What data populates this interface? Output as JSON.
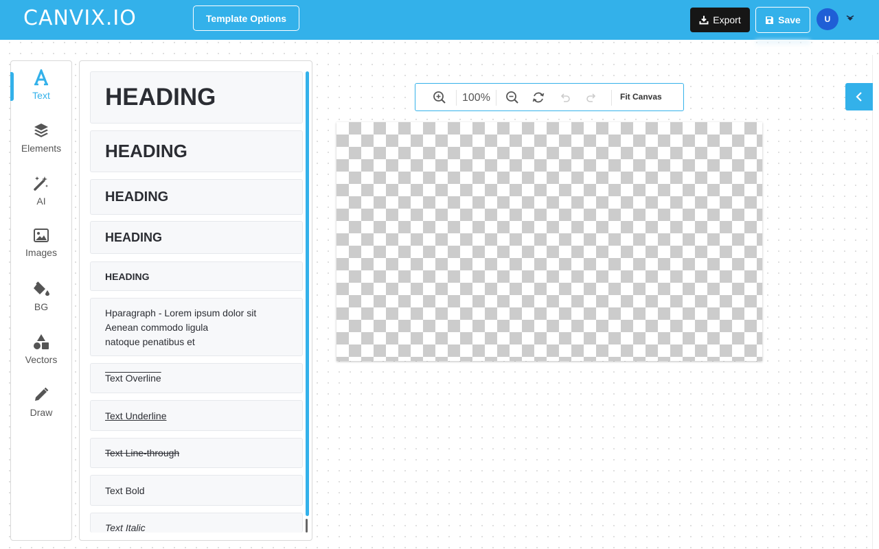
{
  "header": {
    "logo": "CANVIX.IO",
    "template_options": "Template Options",
    "export": "Export",
    "save": "Save",
    "avatar_initial": "U"
  },
  "colors": {
    "accent": "#33b1ea",
    "export_bg": "#161616",
    "avatar_bg": "#1f5fd6"
  },
  "nav": {
    "items": [
      {
        "label": "Text",
        "icon": "text-a-icon",
        "active": true
      },
      {
        "label": "Elements",
        "icon": "layers-icon"
      },
      {
        "label": "AI",
        "icon": "magic-wand-icon"
      },
      {
        "label": "Images",
        "icon": "image-icon"
      },
      {
        "label": "BG",
        "icon": "paint-bucket-icon"
      },
      {
        "label": "Vectors",
        "icon": "shapes-icon"
      },
      {
        "label": "Draw",
        "icon": "pencil-icon"
      }
    ]
  },
  "text_panel": {
    "items": [
      "HEADING",
      "HEADING",
      "HEADING",
      "HEADING",
      "HEADING",
      "Text Overline",
      "Text Underline",
      "Text Line-through",
      "Text Bold",
      "Text Italic"
    ],
    "paragraph_lines": [
      "Hparagraph - Lorem ipsum dolor sit",
      "Aenean commodo ligula",
      "natoque penatibus et"
    ]
  },
  "toolbar": {
    "zoom": "100%",
    "fit": "Fit Canvas"
  }
}
